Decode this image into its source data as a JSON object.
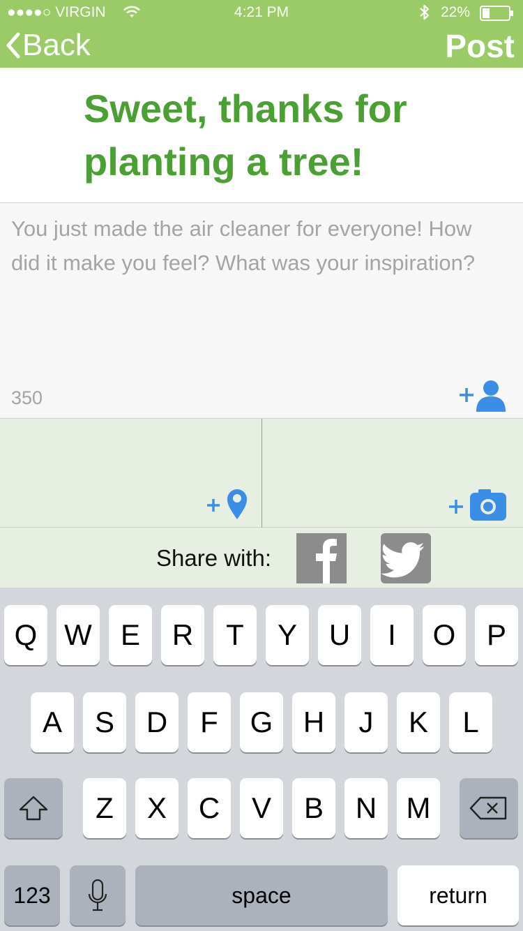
{
  "status_bar": {
    "carrier": "●●●●○ VIRGIN",
    "time": "4:21 PM",
    "battery": "22%",
    "icons": [
      "wifi-icon",
      "bluetooth-icon",
      "battery-icon"
    ]
  },
  "nav": {
    "back_label": "Back",
    "post_label": "Post"
  },
  "headline": "Sweet, thanks for planting a tree!",
  "message": {
    "placeholder": "You just made the air cleaner for everyone! How did it make you feel? What was your inspiration?",
    "char_count": "350"
  },
  "share": {
    "label": "Share with:"
  },
  "keyboard": {
    "row1": [
      "Q",
      "W",
      "E",
      "R",
      "T",
      "Y",
      "U",
      "I",
      "O",
      "P"
    ],
    "row2": [
      "A",
      "S",
      "D",
      "F",
      "G",
      "H",
      "J",
      "K",
      "L"
    ],
    "row3": [
      "Z",
      "X",
      "C",
      "V",
      "B",
      "N",
      "M"
    ],
    "numbers_label": "123",
    "space_label": "space",
    "return_label": "return"
  },
  "colors": {
    "brand_green": "#9bcb66",
    "headline_green": "#4ba033",
    "accent_blue": "#3a8ee6",
    "panel_green": "#e6efe2"
  }
}
